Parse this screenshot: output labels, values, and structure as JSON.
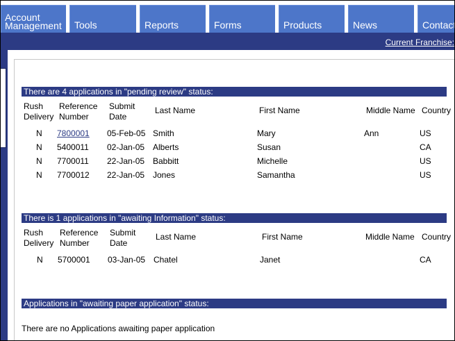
{
  "nav": {
    "tabs": [
      {
        "label": "Account\nManagement"
      },
      {
        "label": "Tools"
      },
      {
        "label": "Reports"
      },
      {
        "label": "Forms"
      },
      {
        "label": "Products"
      },
      {
        "label": "News"
      },
      {
        "label": "Contact"
      }
    ],
    "franchise_link": "Current Franchise:"
  },
  "sections": {
    "pending": {
      "title": "There are 4 applications in \"pending review\" status:",
      "columns": [
        "Rush\nDelivery",
        "Reference\nNumber",
        "Submit\nDate",
        "Last Name",
        "First Name",
        "Middle Name",
        "Country"
      ],
      "rows": [
        {
          "rush": "N",
          "ref": "7800001",
          "date": "05-Feb-05",
          "last": "Smith",
          "first": "Mary",
          "middle": "Ann",
          "country": "US"
        },
        {
          "rush": "N",
          "ref": "5400011",
          "date": "02-Jan-05",
          "last": "Alberts",
          "first": "Susan",
          "middle": "",
          "country": "CA"
        },
        {
          "rush": "N",
          "ref": "7700011",
          "date": "22-Jan-05",
          "last": "Babbitt",
          "first": "Michelle",
          "middle": "",
          "country": "US"
        },
        {
          "rush": "N",
          "ref": "7700012",
          "date": "22-Jan-05",
          "last": "Jones",
          "first": "Samantha",
          "middle": "",
          "country": "US"
        }
      ]
    },
    "awaiting_info": {
      "title": "There is 1 applications in \"awaiting Information\" status:",
      "columns": [
        "Rush\nDelivery",
        "Reference\nNumber",
        "Submit\nDate",
        "Last Name",
        "First Name",
        "Middle Name",
        "Country"
      ],
      "rows": [
        {
          "rush": "N",
          "ref": "5700001",
          "date": "03-Jan-05",
          "last": "Chatel",
          "first": "Janet",
          "middle": "",
          "country": "CA"
        }
      ]
    },
    "awaiting_paper": {
      "title": "Applications in \"awaiting paper application\" status:",
      "message": "There are no Applications awaiting paper application"
    }
  },
  "colors": {
    "nav_tab": "#4d76c9",
    "bar": "#2c3b84",
    "link": "#2c3b84"
  }
}
